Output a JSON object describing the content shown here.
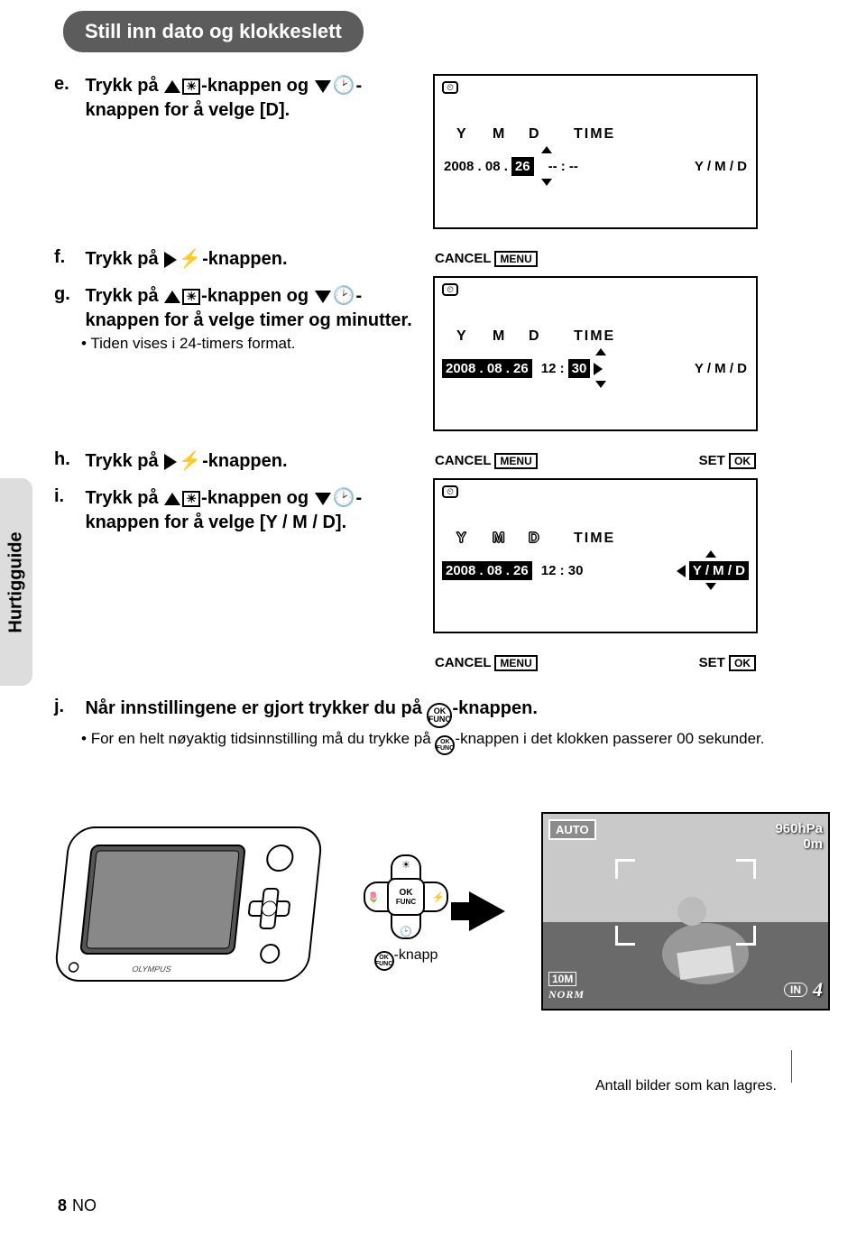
{
  "header": {
    "title": "Still inn dato og klokkeslett"
  },
  "sidebar": {
    "label": "Hurtigguide"
  },
  "steps": {
    "e": {
      "letter": "e.",
      "text_before": "Trykk på ",
      "text_mid": "-knappen og ",
      "text_after": "-knappen for å velge [D]."
    },
    "f": {
      "letter": "f.",
      "text_before": "Trykk på ",
      "text_after": "-knappen."
    },
    "g": {
      "letter": "g.",
      "text_before": "Trykk på ",
      "text_mid": "-knappen og ",
      "text_after": "-knappen for å velge timer og minutter.",
      "sub": "Tiden vises i 24-timers format."
    },
    "h": {
      "letter": "h.",
      "text_before": "Trykk på ",
      "text_after": "-knappen."
    },
    "i": {
      "letter": "i.",
      "text_before": "Trykk på ",
      "text_mid": "-knappen og ",
      "text_after": "-knappen for å velge [Y / M / D]."
    },
    "j": {
      "letter": "j.",
      "text_before": "Når innstillingene er gjort trykker du på ",
      "text_after": "-knappen.",
      "sub_before": "For en helt nøyaktig tidsinnstilling må du trykke på ",
      "sub_after": "-knappen i det klokken passerer 00 sekunder."
    }
  },
  "screen_common": {
    "y": "Y",
    "m": "M",
    "d": "D",
    "time": "TIME",
    "cancel": "CANCEL",
    "menu": "MENU",
    "set": "SET",
    "ok": "OK",
    "format": "Y / M / D"
  },
  "screen1": {
    "date": "2008 . 08 .",
    "day": "26",
    "time": "-- : --"
  },
  "screen2": {
    "date": "2008 . 08 . 26",
    "hour_min": "12 :",
    "min": "30"
  },
  "screen3": {
    "date": "2008 . 08 . 26",
    "time": "12 : 30"
  },
  "dpad": {
    "ok": "OK",
    "func": "FUNC",
    "label": "-knapp"
  },
  "preview": {
    "auto": "AUTO",
    "hpa": "960hPa",
    "depth": "0m",
    "mp": "10M",
    "norm": "NORM",
    "in": "IN",
    "count": "4"
  },
  "caption": "Antall bilder som kan lagres.",
  "page": {
    "num": "8",
    "lang": "NO"
  }
}
